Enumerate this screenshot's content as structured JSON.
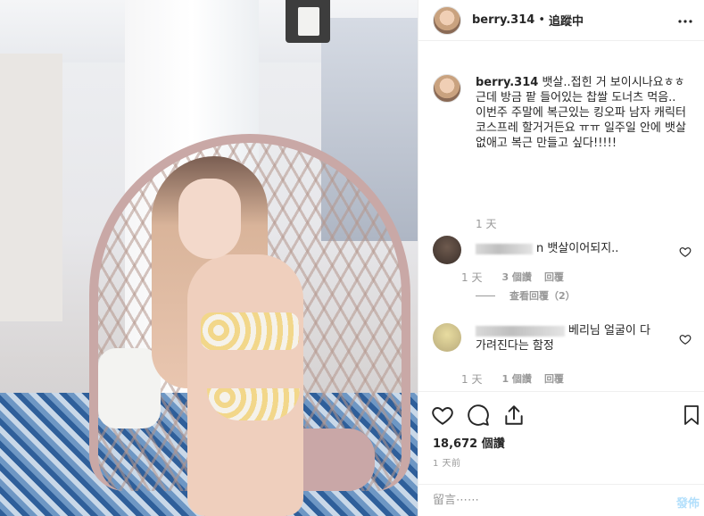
{
  "header": {
    "username": "berry.314",
    "separator": "•",
    "follow_status": "追蹤中",
    "more_icon": "more-horizontal-icon"
  },
  "caption": {
    "username": "berry.314",
    "line1": "뱃살..접힌 거 보이시나요ㅎㅎ",
    "line2": "근데 방금 팥 들어있는 찹쌀 도너츠 먹음..",
    "line3": "이번주 주말에 복근있는 킹오파 남자 캐릭터 코스프레 할거거든요 ㅠㅠ 일주일 안에 뱃살 없애고 복근 만들고 싶다!!!!!",
    "time": "1 天"
  },
  "comments": [
    {
      "name_suffix": "n",
      "text": "뱃살이어되지..",
      "time": "1 天",
      "likes": "3 個讚",
      "reply": "回覆",
      "view_replies": "查看回覆（2）"
    },
    {
      "name_suffix": "",
      "text": "베리님 얼굴이 다 가려진다는 함정",
      "time": "1 天",
      "likes": "1 個讚",
      "reply": "回覆"
    }
  ],
  "actions": {
    "like_icon": "heart-icon",
    "comment_icon": "comment-bubble-icon",
    "share_icon": "share-arrow-icon",
    "save_icon": "bookmark-icon"
  },
  "likes_count": "18,672 個讚",
  "post_time": "1 天前",
  "comment_box": {
    "placeholder": "留言⋯⋯",
    "post_label": "發佈"
  }
}
